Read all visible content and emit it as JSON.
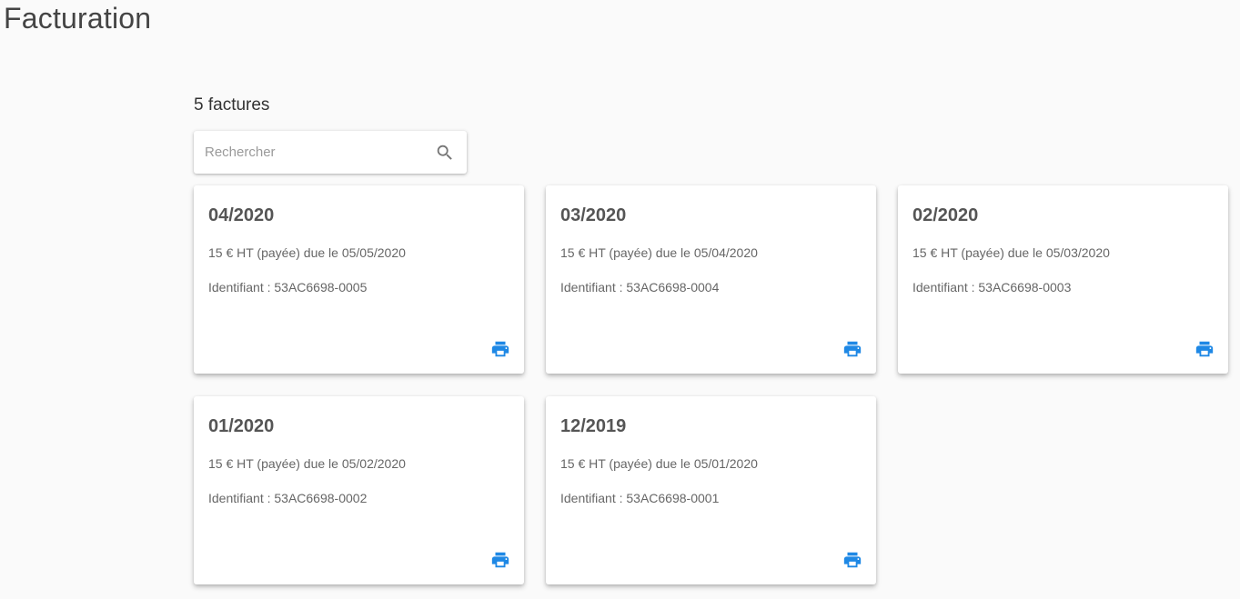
{
  "page": {
    "title": "Facturation"
  },
  "invoices_header": {
    "count_label": "5 factures"
  },
  "search": {
    "placeholder": "Rechercher",
    "value": ""
  },
  "colors": {
    "print_icon": "#1e88e5",
    "search_icon": "#757575"
  },
  "invoices": [
    {
      "period": "04/2020",
      "amount_line": "15 € HT (payée) due le 05/05/2020",
      "id_line": "Identifiant : 53AC6698-0005"
    },
    {
      "period": "03/2020",
      "amount_line": "15 € HT (payée) due le 05/04/2020",
      "id_line": "Identifiant : 53AC6698-0004"
    },
    {
      "period": "02/2020",
      "amount_line": "15 € HT (payée) due le 05/03/2020",
      "id_line": "Identifiant : 53AC6698-0003"
    },
    {
      "period": "01/2020",
      "amount_line": "15 € HT (payée) due le 05/02/2020",
      "id_line": "Identifiant : 53AC6698-0002"
    },
    {
      "period": "12/2019",
      "amount_line": "15 € HT (payée) due le 05/01/2020",
      "id_line": "Identifiant : 53AC6698-0001"
    }
  ]
}
